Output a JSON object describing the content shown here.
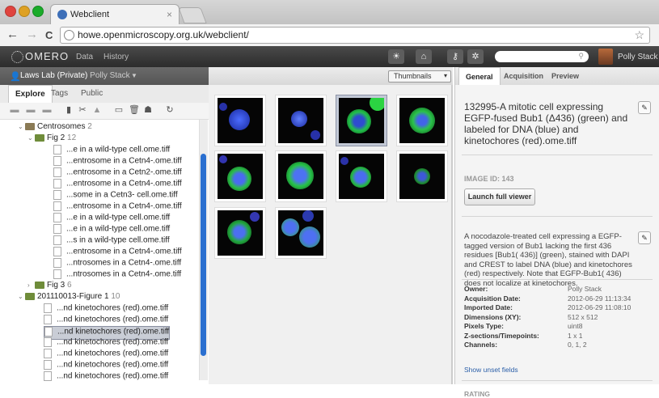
{
  "browser": {
    "tab_title": "Webclient",
    "tab_close": "×",
    "back": "←",
    "forward": "→",
    "reload": "C",
    "url": "howe.openmicroscopy.org.uk/webclient/",
    "bookmark": "☆"
  },
  "header": {
    "logo": "OMERO",
    "menu": [
      "Data",
      "History"
    ],
    "user_name": "Polly Stack"
  },
  "group": {
    "name": "Laws Lab (Private)",
    "user": "Polly Stack"
  },
  "left_tabs": [
    "Explore",
    "Tags",
    "Public"
  ],
  "view_select": {
    "selected": "Thumbnails"
  },
  "tree": [
    {
      "type": "folder",
      "label": "Centrosomes",
      "count": "2",
      "depth": 0,
      "toggle": "⌄"
    },
    {
      "type": "dataset",
      "label": "Fig 2",
      "count": "12",
      "depth": 1,
      "toggle": "⌄"
    },
    {
      "type": "image",
      "label": "...e in a wild-type cell.ome.tiff",
      "depth": 2
    },
    {
      "type": "image",
      "label": "...entrosome in a Cetn4-.ome.tiff",
      "depth": 2
    },
    {
      "type": "image",
      "label": "...entrosome in a Cetn2-.ome.tiff",
      "depth": 2
    },
    {
      "type": "image",
      "label": "...entrosome in a Cetn4-.ome.tiff",
      "depth": 2
    },
    {
      "type": "image",
      "label": "...some in a Cetn3- cell.ome.tiff",
      "depth": 2
    },
    {
      "type": "image",
      "label": "...entrosome in a Cetn4-.ome.tiff",
      "depth": 2
    },
    {
      "type": "image",
      "label": "...e in a wild-type cell.ome.tiff",
      "depth": 2
    },
    {
      "type": "image",
      "label": "...e in a wild-type cell.ome.tiff",
      "depth": 2
    },
    {
      "type": "image",
      "label": "...s in a wild-type cell.ome.tiff",
      "depth": 2
    },
    {
      "type": "image",
      "label": "...entrosome in a Cetn4-.ome.tiff",
      "depth": 2
    },
    {
      "type": "image",
      "label": "...ntrosomes in a Cetn4-.ome.tiff",
      "depth": 2
    },
    {
      "type": "image",
      "label": "...ntrosomes in a Cetn4-.ome.tiff",
      "depth": 2
    },
    {
      "type": "dataset",
      "label": "Fig 3",
      "count": "6",
      "depth": 1,
      "toggle": "›"
    },
    {
      "type": "dataset",
      "label": "201110013-Figure 1",
      "count": "10",
      "depth": 0,
      "toggle": "⌄"
    },
    {
      "type": "image",
      "label": "...nd kinetochores (red).ome.tiff",
      "depth": 1
    },
    {
      "type": "image",
      "label": "...nd kinetochores (red).ome.tiff",
      "depth": 1
    },
    {
      "type": "image",
      "label": "...nd kinetochores (red).ome.tiff",
      "depth": 1,
      "selected": true
    },
    {
      "type": "image",
      "label": "...nd kinetochores (red).ome.tiff",
      "depth": 1
    },
    {
      "type": "image",
      "label": "...nd kinetochores (red).ome.tiff",
      "depth": 1
    },
    {
      "type": "image",
      "label": "...nd kinetochores (red).ome.tiff",
      "depth": 1
    },
    {
      "type": "image",
      "label": "...nd kinetochores (red).ome.tiff",
      "depth": 1
    }
  ],
  "right_tabs": [
    "General",
    "Acquisition",
    "Preview"
  ],
  "general": {
    "title": "132995-A mitotic cell expressing EGFP-fused Bub1 (Δ436) (green) and labeled for DNA (blue) and kinetochores (red).ome.tiff",
    "image_id": "IMAGE ID: 143",
    "launch_label": "Launch full viewer",
    "description": "A nocodazole-treated cell expressing a EGFP-tagged version of Bub1 lacking the first 436 residues [Bub1( 436)] (green), stained with DAPI and CREST to label DNA (blue) and kinetochores (red) respectively. Note that EGFP-Bub1( 436) does not localize at kinetochores.",
    "metadata": [
      {
        "key": "Owner:",
        "value": "Polly Stack"
      },
      {
        "key": "Acquisition Date:",
        "value": "2012-06-29 11:13:34"
      },
      {
        "key": "Imported Date:",
        "value": "2012-06-29 11:08:10"
      },
      {
        "key": "Dimensions (XY):",
        "value": "512 x 512"
      },
      {
        "key": "Pixels Type:",
        "value": "uint8"
      },
      {
        "key": "Z-sections/Timepoints:",
        "value": "1 x 1"
      },
      {
        "key": "Channels:",
        "value": "0, 1, 2"
      }
    ],
    "show_unset": "Show unset fields",
    "rating_label": "RATING"
  }
}
